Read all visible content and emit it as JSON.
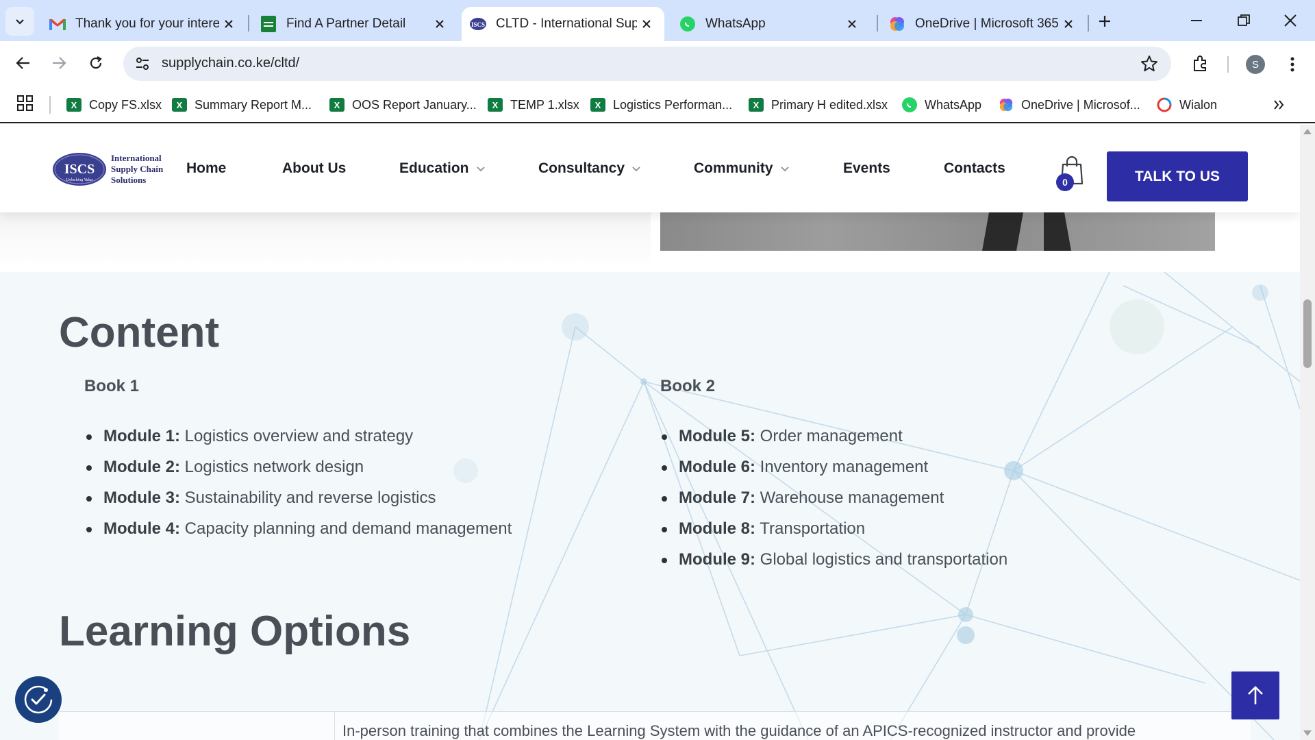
{
  "browser": {
    "tabs": [
      {
        "title": "Thank you for your intere",
        "icon": "gmail-icon"
      },
      {
        "title": "Find A Partner Detail",
        "icon": "sheets-icon"
      },
      {
        "title": "CLTD - International Sup",
        "icon": "iscs-icon",
        "active": true
      },
      {
        "title": "WhatsApp",
        "icon": "whatsapp-icon"
      },
      {
        "title": "OneDrive | Microsoft 365",
        "icon": "onedrive-icon"
      }
    ],
    "url": "supplychain.co.ke/cltd/",
    "profile_initial": "S",
    "bookmarks": [
      {
        "label": "Copy FS.xlsx",
        "icon": "excel-icon"
      },
      {
        "label": "Summary Report M...",
        "icon": "excel-icon"
      },
      {
        "label": "OOS Report January...",
        "icon": "excel-icon"
      },
      {
        "label": "TEMP 1.xlsx",
        "icon": "excel-icon"
      },
      {
        "label": "Logistics Performan...",
        "icon": "excel-icon"
      },
      {
        "label": "Primary H edited.xlsx",
        "icon": "excel-icon"
      },
      {
        "label": "WhatsApp",
        "icon": "whatsapp-icon"
      },
      {
        "label": "OneDrive | Microsof...",
        "icon": "onedrive-icon"
      },
      {
        "label": "Wialon",
        "icon": "wialon-icon"
      }
    ]
  },
  "site": {
    "logo": {
      "line1": "International",
      "line2": "Supply Chain",
      "line3": "Solutions",
      "mark": "ISCS",
      "tagline": "Unlocking Value"
    },
    "nav": [
      {
        "label": "Home",
        "dropdown": false
      },
      {
        "label": "About Us",
        "dropdown": false
      },
      {
        "label": "Education",
        "dropdown": true
      },
      {
        "label": "Consultancy",
        "dropdown": true
      },
      {
        "label": "Community",
        "dropdown": true
      },
      {
        "label": "Events",
        "dropdown": false
      },
      {
        "label": "Contacts",
        "dropdown": false
      }
    ],
    "cart_count": "0",
    "cta_label": "TALK TO US",
    "brand_color": "#2d2da5"
  },
  "content": {
    "heading": "Content",
    "book1": {
      "title": "Book 1",
      "modules": [
        {
          "key": "Module 1:",
          "text": " Logistics overview and strategy"
        },
        {
          "key": "Module 2:",
          "text": " Logistics network design"
        },
        {
          "key": "Module 3:",
          "text": " Sustainability and reverse logistics"
        },
        {
          "key": "Module 4:",
          "text": " Capacity planning and demand management"
        }
      ]
    },
    "book2": {
      "title": "Book 2",
      "modules": [
        {
          "key": "Module 5:",
          "text": " Order management"
        },
        {
          "key": "Module 6:",
          "text": " Inventory management"
        },
        {
          "key": "Module 7:",
          "text": " Warehouse management"
        },
        {
          "key": "Module 8:",
          "text": " Transportation"
        },
        {
          "key": "Module 9:",
          "text": " Global logistics and transportation"
        }
      ]
    }
  },
  "learning": {
    "heading": "Learning Options",
    "partial_text": "In-person training that combines the Learning System with the guidance of an APICS-recognized instructor and provide"
  }
}
